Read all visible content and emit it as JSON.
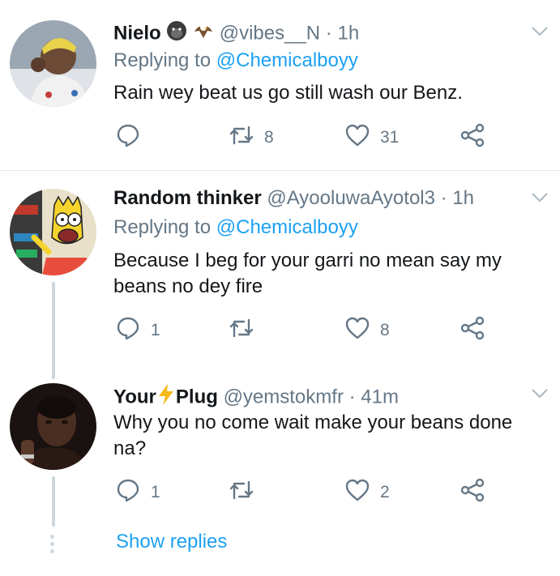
{
  "tweets": [
    {
      "name": "Nielo",
      "name_emojis": [
        "gorilla-emoji",
        "eagle-emoji"
      ],
      "handle": "@vibes__N",
      "time": "1h",
      "replying_prefix": "Replying to ",
      "replying_to": "@Chemicalboyy",
      "text": "Rain wey beat us go still wash our Benz.",
      "actions": {
        "replies": "",
        "retweets": "8",
        "likes": "31"
      }
    },
    {
      "name": "Random thinker",
      "handle": "@AyooluwaAyotol3",
      "time": "1h",
      "replying_prefix": "Replying to ",
      "replying_to": "@Chemicalboyy",
      "text": "Because I beg for your garri no mean say my beans no dey fire",
      "actions": {
        "replies": "1",
        "retweets": "",
        "likes": "8"
      }
    },
    {
      "name_part1": "Your",
      "name_emoji": "lightning-emoji",
      "name_part2": "Plug",
      "handle": "@yemstokmfr",
      "time": "41m",
      "text": "Why you no come wait make your beans done na?",
      "actions": {
        "replies": "1",
        "retweets": "",
        "likes": "2"
      }
    }
  ],
  "separator": "·",
  "show_replies": "Show replies",
  "colors": {
    "accent": "#1da1f2",
    "muted": "#657786",
    "text": "#14171a",
    "divider": "#e1e8ed"
  }
}
